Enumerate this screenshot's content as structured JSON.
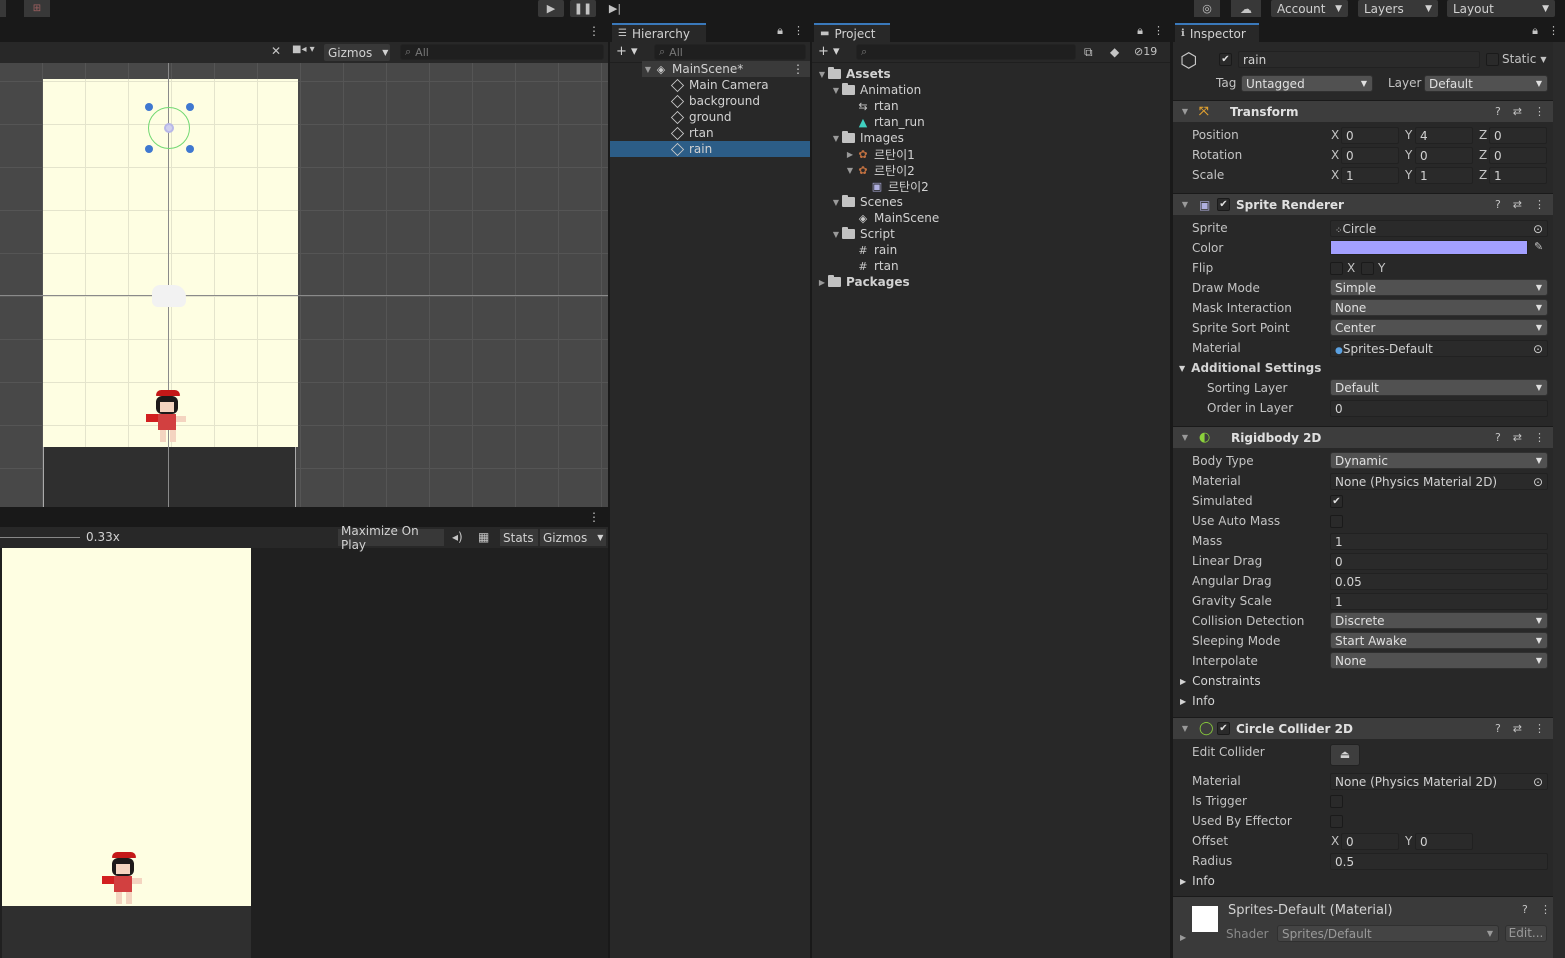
{
  "topbar": {
    "account": "Account",
    "layers": "Layers",
    "layout": "Layout"
  },
  "scene": {
    "gizmos": "Gizmos",
    "search_placeholder": "All"
  },
  "game": {
    "scale": "0.33x",
    "maximize": "Maximize On Play",
    "stats": "Stats",
    "gizmos": "Gizmos"
  },
  "hierarchy": {
    "tab": "Hierarchy",
    "search_placeholder": "All",
    "scene_name": "MainScene*",
    "items": [
      "Main Camera",
      "background",
      "ground",
      "rtan",
      "rain"
    ],
    "selected": "rain"
  },
  "project": {
    "tab": "Project",
    "hidden_count": "19",
    "tree": [
      {
        "label": "Assets",
        "type": "folder",
        "bold": true
      },
      {
        "label": "Animation",
        "type": "folder"
      },
      {
        "label": "rtan",
        "type": "controller"
      },
      {
        "label": "rtan_run",
        "type": "anim"
      },
      {
        "label": "Images",
        "type": "folder"
      },
      {
        "label": "르탄이1",
        "type": "sprite"
      },
      {
        "label": "르탄이2",
        "type": "sprite"
      },
      {
        "label": "르탄이2",
        "type": "subsprite"
      },
      {
        "label": "Scenes",
        "type": "folder"
      },
      {
        "label": "MainScene",
        "type": "scene"
      },
      {
        "label": "Script",
        "type": "folder"
      },
      {
        "label": "rain",
        "type": "script"
      },
      {
        "label": "rtan",
        "type": "script"
      },
      {
        "label": "Packages",
        "type": "folder",
        "bold": true
      }
    ]
  },
  "inspector": {
    "tab": "Inspector",
    "object_name": "rain",
    "static_label": "Static",
    "tag_label": "Tag",
    "tag_value": "Untagged",
    "layer_label": "Layer",
    "layer_value": "Default",
    "transform": {
      "title": "Transform",
      "position_label": "Position",
      "position": [
        "0",
        "4",
        "0"
      ],
      "rotation_label": "Rotation",
      "rotation": [
        "0",
        "0",
        "0"
      ],
      "scale_label": "Scale",
      "scale": [
        "1",
        "1",
        "1"
      ]
    },
    "sprite_renderer": {
      "title": "Sprite Renderer",
      "sprite_label": "Sprite",
      "sprite": "Circle",
      "color_label": "Color",
      "color": "#a3a0ff",
      "flip_label": "Flip",
      "flip_x": "X",
      "flip_y": "Y",
      "draw_mode_label": "Draw Mode",
      "draw_mode": "Simple",
      "mask_label": "Mask Interaction",
      "mask": "None",
      "sort_point_label": "Sprite Sort Point",
      "sort_point": "Center",
      "material_label": "Material",
      "material": "Sprites-Default",
      "additional": "Additional Settings",
      "sorting_layer_label": "Sorting Layer",
      "sorting_layer": "Default",
      "order_label": "Order in Layer",
      "order": "0"
    },
    "rigidbody": {
      "title": "Rigidbody 2D",
      "body_type_label": "Body Type",
      "body_type": "Dynamic",
      "material_label": "Material",
      "material": "None (Physics Material 2D)",
      "simulated_label": "Simulated",
      "auto_mass_label": "Use Auto Mass",
      "mass_label": "Mass",
      "mass": "1",
      "linear_drag_label": "Linear Drag",
      "linear_drag": "0",
      "angular_drag_label": "Angular Drag",
      "angular_drag": "0.05",
      "gravity_label": "Gravity Scale",
      "gravity": "1",
      "collision_label": "Collision Detection",
      "collision": "Discrete",
      "sleeping_label": "Sleeping Mode",
      "sleeping": "Start Awake",
      "interpolate_label": "Interpolate",
      "interpolate": "None",
      "constraints": "Constraints",
      "info": "Info"
    },
    "collider": {
      "title": "Circle Collider 2D",
      "edit_label": "Edit Collider",
      "material_label": "Material",
      "material": "None (Physics Material 2D)",
      "trigger_label": "Is Trigger",
      "effector_label": "Used By Effector",
      "offset_label": "Offset",
      "offset": [
        "0",
        "0"
      ],
      "radius_label": "Radius",
      "radius": "0.5",
      "info": "Info"
    },
    "material_block": {
      "title": "Sprites-Default (Material)",
      "shader_label": "Shader",
      "shader": "Sprites/Default",
      "edit": "Edit..."
    }
  }
}
